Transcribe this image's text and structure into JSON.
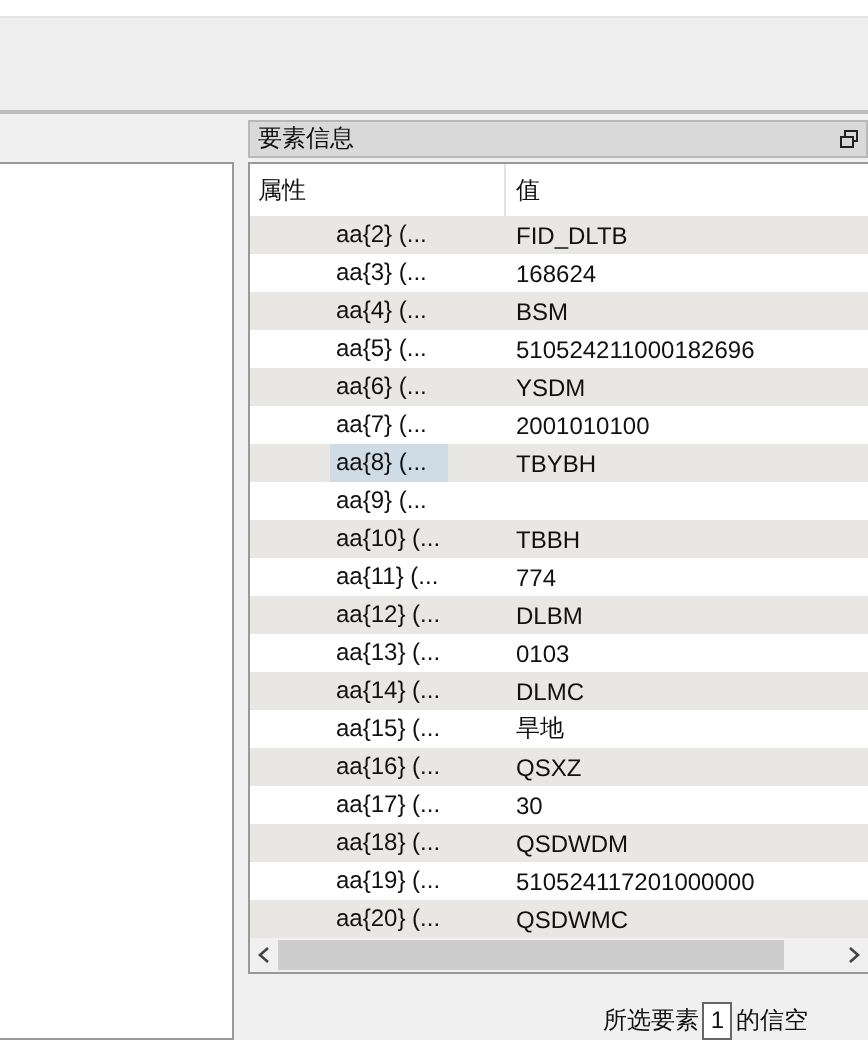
{
  "panel": {
    "title": "要素信息"
  },
  "table": {
    "columns": [
      "属性",
      "值"
    ],
    "rows": [
      {
        "attribute": "aa{2} (...",
        "value": "FID_DLTB",
        "selected": false
      },
      {
        "attribute": "aa{3} (...",
        "value": "168624",
        "selected": false
      },
      {
        "attribute": "aa{4} (...",
        "value": "BSM",
        "selected": false
      },
      {
        "attribute": "aa{5} (...",
        "value": "510524211000182696",
        "selected": false
      },
      {
        "attribute": "aa{6} (...",
        "value": "YSDM",
        "selected": false
      },
      {
        "attribute": "aa{7} (...",
        "value": "2001010100",
        "selected": false
      },
      {
        "attribute": "aa{8} (...",
        "value": "TBYBH",
        "selected": true
      },
      {
        "attribute": "aa{9} (...",
        "selected": false
      },
      {
        "attribute": "aa{10} (...",
        "value": "TBBH",
        "selected": false
      },
      {
        "attribute": "aa{11} (...",
        "value": "774",
        "selected": false
      },
      {
        "attribute": "aa{12} (...",
        "value": "DLBM",
        "selected": false
      },
      {
        "attribute": "aa{13} (...",
        "value": "0103",
        "selected": false
      },
      {
        "attribute": "aa{14} (...",
        "value": "DLMC",
        "selected": false
      },
      {
        "attribute": "aa{15} (...",
        "value": "旱地",
        "selected": false
      },
      {
        "attribute": "aa{16} (...",
        "value": "QSXZ",
        "selected": false
      },
      {
        "attribute": "aa{17} (...",
        "value": "30",
        "selected": false
      },
      {
        "attribute": "aa{18} (...",
        "value": "QSDWDM",
        "selected": false
      },
      {
        "attribute": "aa{19} (...",
        "value": "510524117201000000",
        "selected": false
      },
      {
        "attribute": "aa{20} (...",
        "value": "QSDWMC",
        "selected": false
      }
    ]
  },
  "footer": {
    "label": "所选要素",
    "value": "1",
    "suffix": "的信空"
  }
}
